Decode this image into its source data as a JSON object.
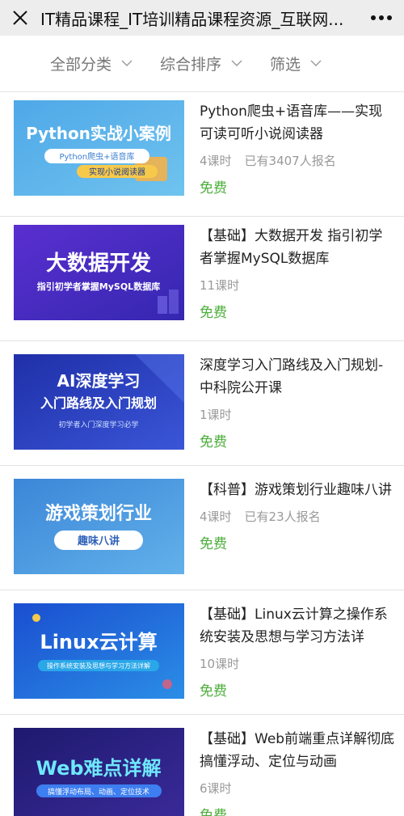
{
  "header": {
    "title": "IT精品课程_IT培训精品课程资源_互联网...",
    "close_icon": "close-icon",
    "more_icon": "more-icon"
  },
  "filters": [
    {
      "label": "全部分类"
    },
    {
      "label": "综合排序"
    },
    {
      "label": "筛选"
    }
  ],
  "courses": [
    {
      "title": "Python爬虫+语音库——实现可读可听小说阅读器",
      "lessons": "4课时",
      "enrolled": "已有3407人报名",
      "price": "免费",
      "thumb": {
        "main": "Python实战小案例",
        "sub": "Python爬虫+语音库",
        "sub2": "实现小说阅读器",
        "bg": "#5bb3e6"
      }
    },
    {
      "title": "【基础】大数据开发 指引初学者掌握MySQL数据库",
      "lessons": "11课时",
      "enrolled": "",
      "price": "免费",
      "thumb": {
        "main": "大数据开发",
        "sub": "指引初学者掌握MySQL数据库",
        "bg": "#4a32c8"
      }
    },
    {
      "title": "深度学习入门路线及入门规划-中科院公开课",
      "lessons": "1课时",
      "enrolled": "",
      "price": "免费",
      "thumb": {
        "main": "AI深度学习",
        "sub": "入门路线及入门规划",
        "sub2": "初学者入门深度学习必学",
        "bg": "#2638b8"
      }
    },
    {
      "title": "【科普】游戏策划行业趣味八讲",
      "lessons": "4课时",
      "enrolled": "已有23人报名",
      "price": "免费",
      "thumb": {
        "main": "游戏策划行业",
        "sub": "趣味八讲",
        "bg": "#4a8fd8"
      }
    },
    {
      "title": "【基础】Linux云计算之操作系统安装及思想与学习方法详",
      "lessons": "10课时",
      "enrolled": "",
      "price": "免费",
      "thumb": {
        "main": "Linux云计算",
        "sub": "操作系统安装及思想与学习方法详解",
        "bg": "#1f5fd6"
      }
    },
    {
      "title": "【基础】Web前端重点详解彻底搞懂浮动、定位与动画",
      "lessons": "6课时",
      "enrolled": "",
      "price": "免费",
      "thumb": {
        "main": "Web难点详解",
        "sub": "搞懂浮动布局、动画、定位技术",
        "bg": "#2a1f7a"
      }
    }
  ],
  "colors": {
    "accent_green": "#4cae3a",
    "meta_gray": "#999999"
  }
}
